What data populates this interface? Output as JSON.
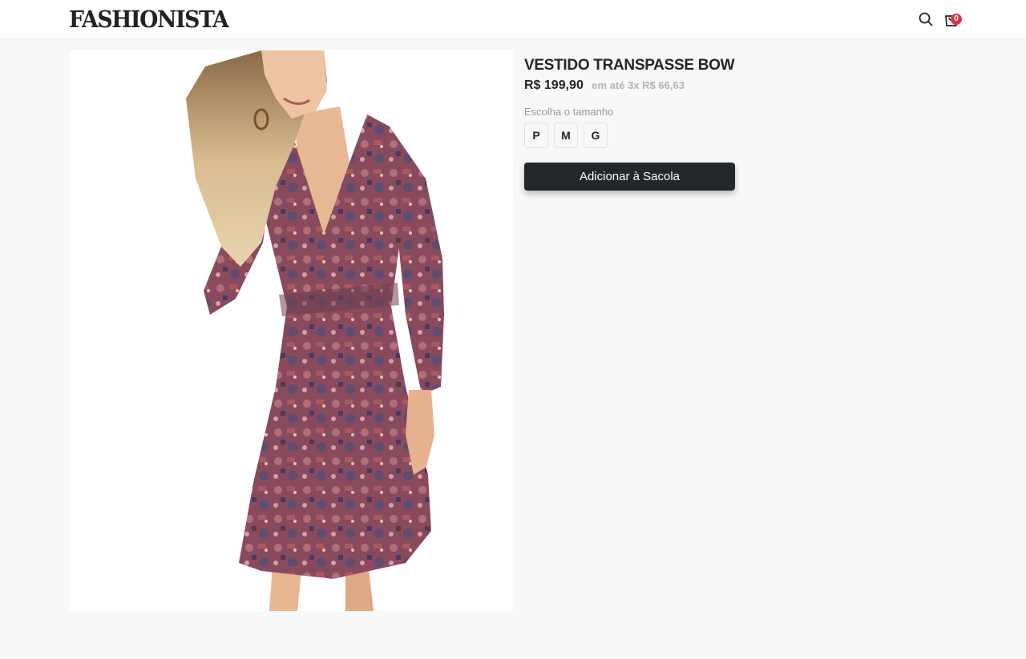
{
  "header": {
    "logo": "FASHIONISTA",
    "search_icon": "search-icon",
    "cart_icon": "shopping-bag-icon",
    "cart_count": "0"
  },
  "product": {
    "image_alt": "Vestido Transpasse Bow",
    "title": "VESTIDO TRANSPASSE BOW",
    "price": "R$ 199,90",
    "installments": "em até 3x R$ 66,63",
    "size_label": "Escolha o tamanho",
    "sizes": [
      "P",
      "M",
      "G"
    ],
    "add_button": "Adicionar à Sacola"
  },
  "colors": {
    "background": "#f8f8f8",
    "header": "#ffffff",
    "badge": "#dc3545",
    "button": "#23262b",
    "installments": "#adb5bd"
  }
}
